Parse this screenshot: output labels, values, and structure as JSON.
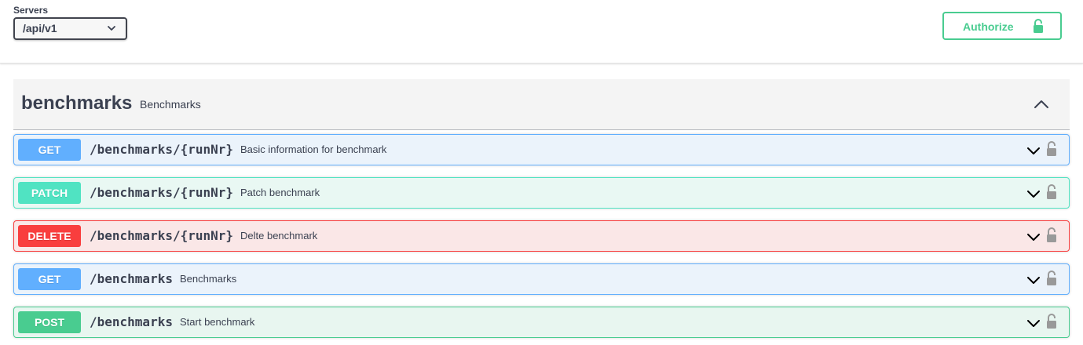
{
  "servers": {
    "label": "Servers",
    "selected": "/api/v1"
  },
  "authorize": {
    "label": "Authorize"
  },
  "tag": {
    "name": "benchmarks",
    "description": "Benchmarks"
  },
  "operations": [
    {
      "method": "GET",
      "path": "/benchmarks/{runNr}",
      "summary": "Basic information for benchmark"
    },
    {
      "method": "PATCH",
      "path": "/benchmarks/{runNr}",
      "summary": "Patch benchmark"
    },
    {
      "method": "DELETE",
      "path": "/benchmarks/{runNr}",
      "summary": "Delte benchmark"
    },
    {
      "method": "GET",
      "path": "/benchmarks",
      "summary": "Benchmarks"
    },
    {
      "method": "POST",
      "path": "/benchmarks",
      "summary": "Start benchmark"
    }
  ],
  "colors": {
    "get": "#61affe",
    "get_bg": "#ebf3fb",
    "patch": "#50e3c2",
    "patch_bg": "#e9f8f3",
    "delete": "#f93e3e",
    "delete_bg": "#fae7e7",
    "post": "#49cc90",
    "post_bg": "#e8f6f0",
    "authorize": "#49cc90"
  },
  "icons": {
    "server_dropdown": "chevron-down-icon",
    "authorize": "unlocked-padlock-icon",
    "tag_toggle": "chevron-up-icon",
    "operation_expand": "chevron-down-icon",
    "operation_auth": "unlocked-padlock-icon"
  }
}
